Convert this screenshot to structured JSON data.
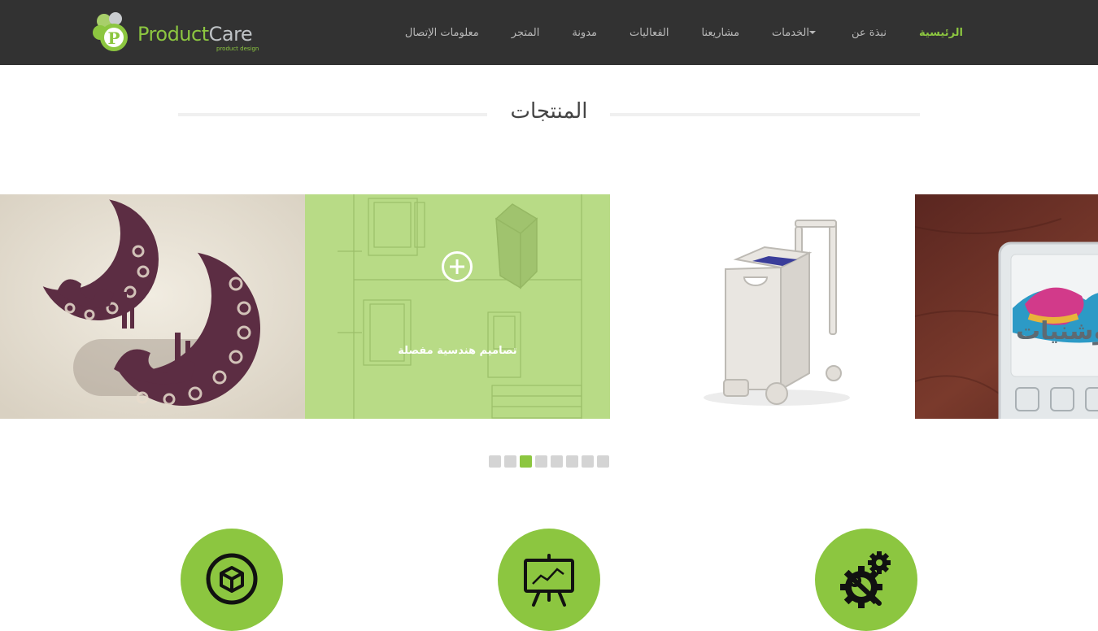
{
  "brand": {
    "name_part1": "Product",
    "name_part2": "Care",
    "tagline": "product design",
    "logo_letter": "P",
    "color": "#8cc640"
  },
  "nav": {
    "items": [
      {
        "label": "الرئيسية",
        "active": true
      },
      {
        "label": "نبذة عن"
      },
      {
        "label": "الخدمات",
        "dropdown": true
      },
      {
        "label": "مشاريعنا"
      },
      {
        "label": "الفعاليات"
      },
      {
        "label": "مدونة"
      },
      {
        "label": "المتجر"
      },
      {
        "label": "معلومات الإتصال"
      }
    ]
  },
  "section": {
    "title": "المنتجات"
  },
  "carousel": {
    "hover_caption": "تصاميم هندسية مفصلة",
    "slide_text": "وشنيات",
    "dots": 8,
    "active_dot": 3
  },
  "features": [
    {
      "icon": "cube-icon"
    },
    {
      "icon": "presentation-chart-icon"
    },
    {
      "icon": "gear-wrench-icon"
    }
  ]
}
